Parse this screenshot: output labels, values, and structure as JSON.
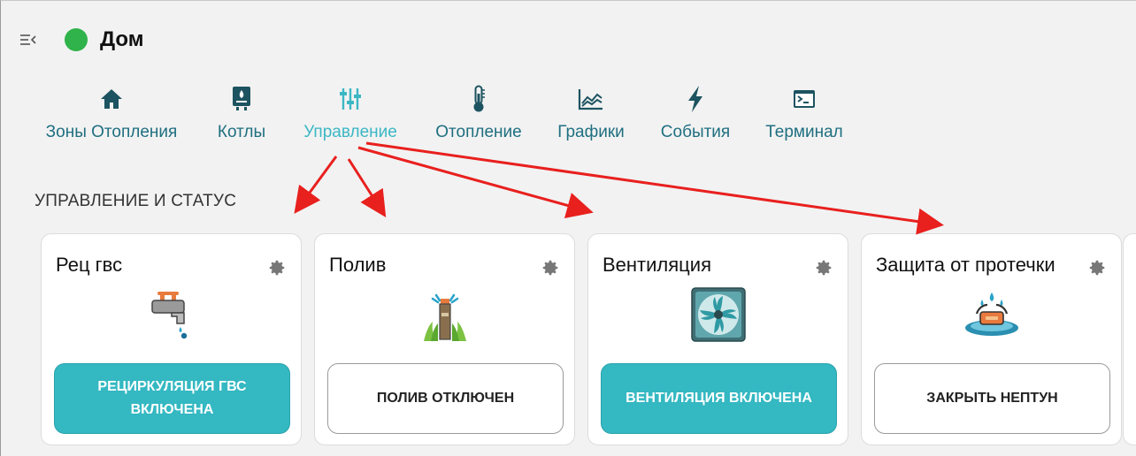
{
  "header": {
    "title": "Дом",
    "status_color": "#2fb34a"
  },
  "tabs": [
    {
      "label": "Зоны Отопления",
      "icon": "home-icon"
    },
    {
      "label": "Котлы",
      "icon": "boiler-icon"
    },
    {
      "label": "Управление",
      "icon": "sliders-icon",
      "active": true
    },
    {
      "label": "Отопление",
      "icon": "thermometer-icon"
    },
    {
      "label": "Графики",
      "icon": "chart-icon"
    },
    {
      "label": "События",
      "icon": "lightning-icon"
    },
    {
      "label": "Терминал",
      "icon": "terminal-icon"
    }
  ],
  "section": {
    "title": "УПРАВЛЕНИЕ И СТАТУС"
  },
  "cards": [
    {
      "title": "Рец гвс",
      "icon": "faucet-icon",
      "button": "РЕЦИРКУЛЯЦИЯ ГВС ВКЛЮЧЕНА",
      "button_state": "on"
    },
    {
      "title": "Полив",
      "icon": "sprinkler-icon",
      "button": "ПОЛИВ ОТКЛЮЧЕН",
      "button_state": "off"
    },
    {
      "title": "Вентиляция",
      "icon": "fan-icon",
      "button": "ВЕНТИЛЯЦИЯ ВКЛЮЧЕНА",
      "button_state": "on"
    },
    {
      "title": "Защита от протечки",
      "icon": "water-leak-icon",
      "button": "ЗАКРЫТЬ НЕПТУН",
      "button_state": "off"
    }
  ],
  "colors": {
    "accent": "#34b8c2",
    "tab_text": "#1f6f80",
    "annotation_arrow": "#e8201e"
  }
}
